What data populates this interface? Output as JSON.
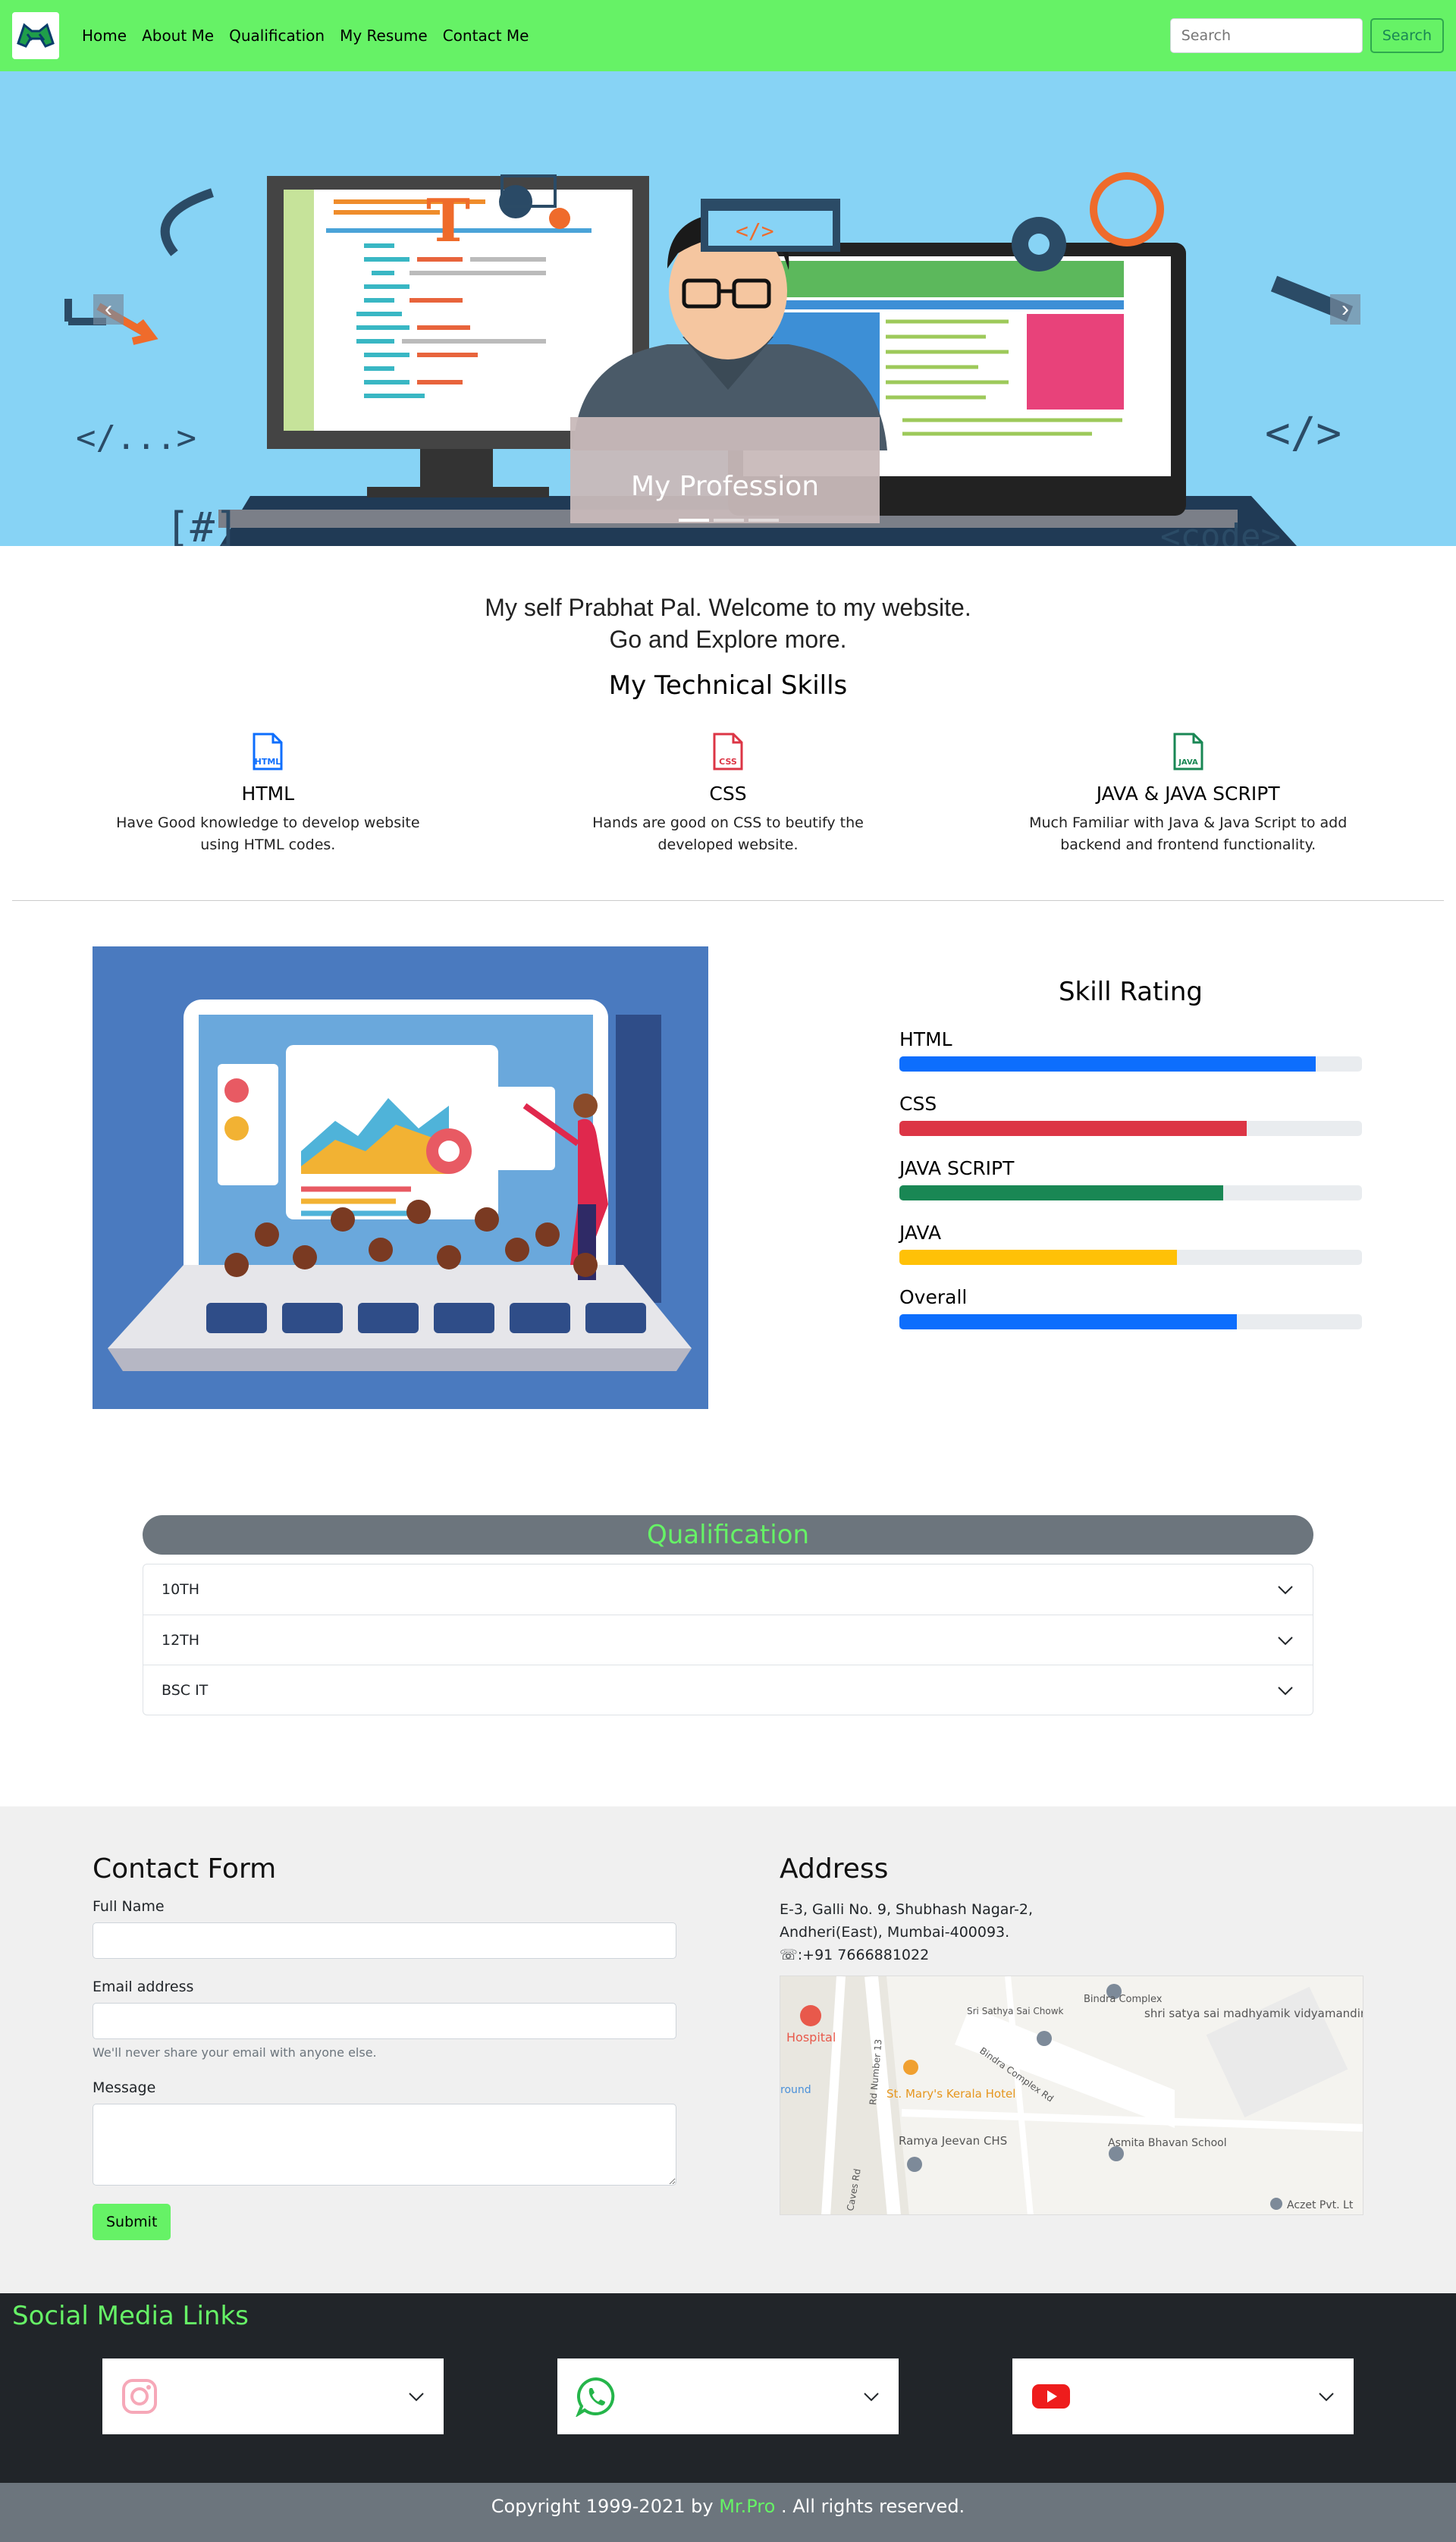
{
  "nav": {
    "links": [
      "Home",
      "About Me",
      "Qualification",
      "My Resume",
      "Contact Me"
    ],
    "search_placeholder": "Search",
    "search_button": "Search"
  },
  "hero": {
    "caption": "My Profession",
    "slides": 3,
    "active_slide": 1,
    "decor": {
      "code1": "</...>",
      "hash": "[#]",
      "code2": "</>",
      "code3": "<code>",
      "t": "T",
      "tag": "</>"
    }
  },
  "intro": {
    "line1": "My self Prabhat Pal. Welcome to my website.",
    "line2": "Go and Explore more.",
    "skills_title": "My Technical Skills"
  },
  "skills": [
    {
      "icon": "html-file-icon",
      "badge": "HTML",
      "color": "#0d6efd",
      "title": "HTML",
      "desc": "Have Good knowledge to develop website using HTML codes."
    },
    {
      "icon": "css-file-icon",
      "badge": "CSS",
      "color": "#dc3545",
      "title": "CSS",
      "desc": "Hands are good on CSS to beutify the developed website."
    },
    {
      "icon": "java-file-icon",
      "badge": "JAVA",
      "color": "#198754",
      "title": "JAVA & JAVA SCRIPT",
      "desc": "Much Familiar with Java & Java Script to add backend and frontend functionality."
    }
  ],
  "rating": {
    "title": "Skill Rating",
    "bars": [
      {
        "label": "HTML",
        "percent": 90,
        "color": "#0d6efd"
      },
      {
        "label": "CSS",
        "percent": 75,
        "color": "#dc3545"
      },
      {
        "label": "JAVA SCRIPT",
        "percent": 70,
        "color": "#198754"
      },
      {
        "label": "JAVA",
        "percent": 60,
        "color": "#ffc107"
      },
      {
        "label": "Overall",
        "percent": 73,
        "color": "#0d6efd"
      }
    ]
  },
  "qualification": {
    "title": "Qualification",
    "items": [
      "10TH",
      "12TH",
      "BSC IT"
    ]
  },
  "contact": {
    "title": "Contact Form",
    "name_label": "Full Name",
    "email_label": "Email address",
    "email_help": "We'll never share your email with anyone else.",
    "message_label": "Message",
    "submit": "Submit"
  },
  "address": {
    "title": "Address",
    "line1": "E-3, Galli No. 9, Shubhash Nagar-2,",
    "line2": "Andheri(East), Mumbai-400093.",
    "phone": ":+91 7666881022",
    "map_labels": [
      "Hospital",
      "Sri Sathya Sai Chowk",
      "Bindra Complex",
      "shri satya sai madhyamik vidyamandir school",
      "St. Mary's Kerala Hotel",
      "Ramya Jeevan CHS",
      "Asmita Bhavan School",
      "Aczet Pvt. Lt",
      "Rd Number 13",
      "Bindra Complex Rd",
      "round",
      "Caves Rd"
    ]
  },
  "social": {
    "title": "Social Media Links",
    "cards": [
      "instagram-icon",
      "whatsapp-icon",
      "youtube-icon"
    ]
  },
  "footer": {
    "prefix": "Copyright 1999-2021 by",
    "brand": "Mr.Pro",
    "suffix": ". All rights reserved."
  }
}
